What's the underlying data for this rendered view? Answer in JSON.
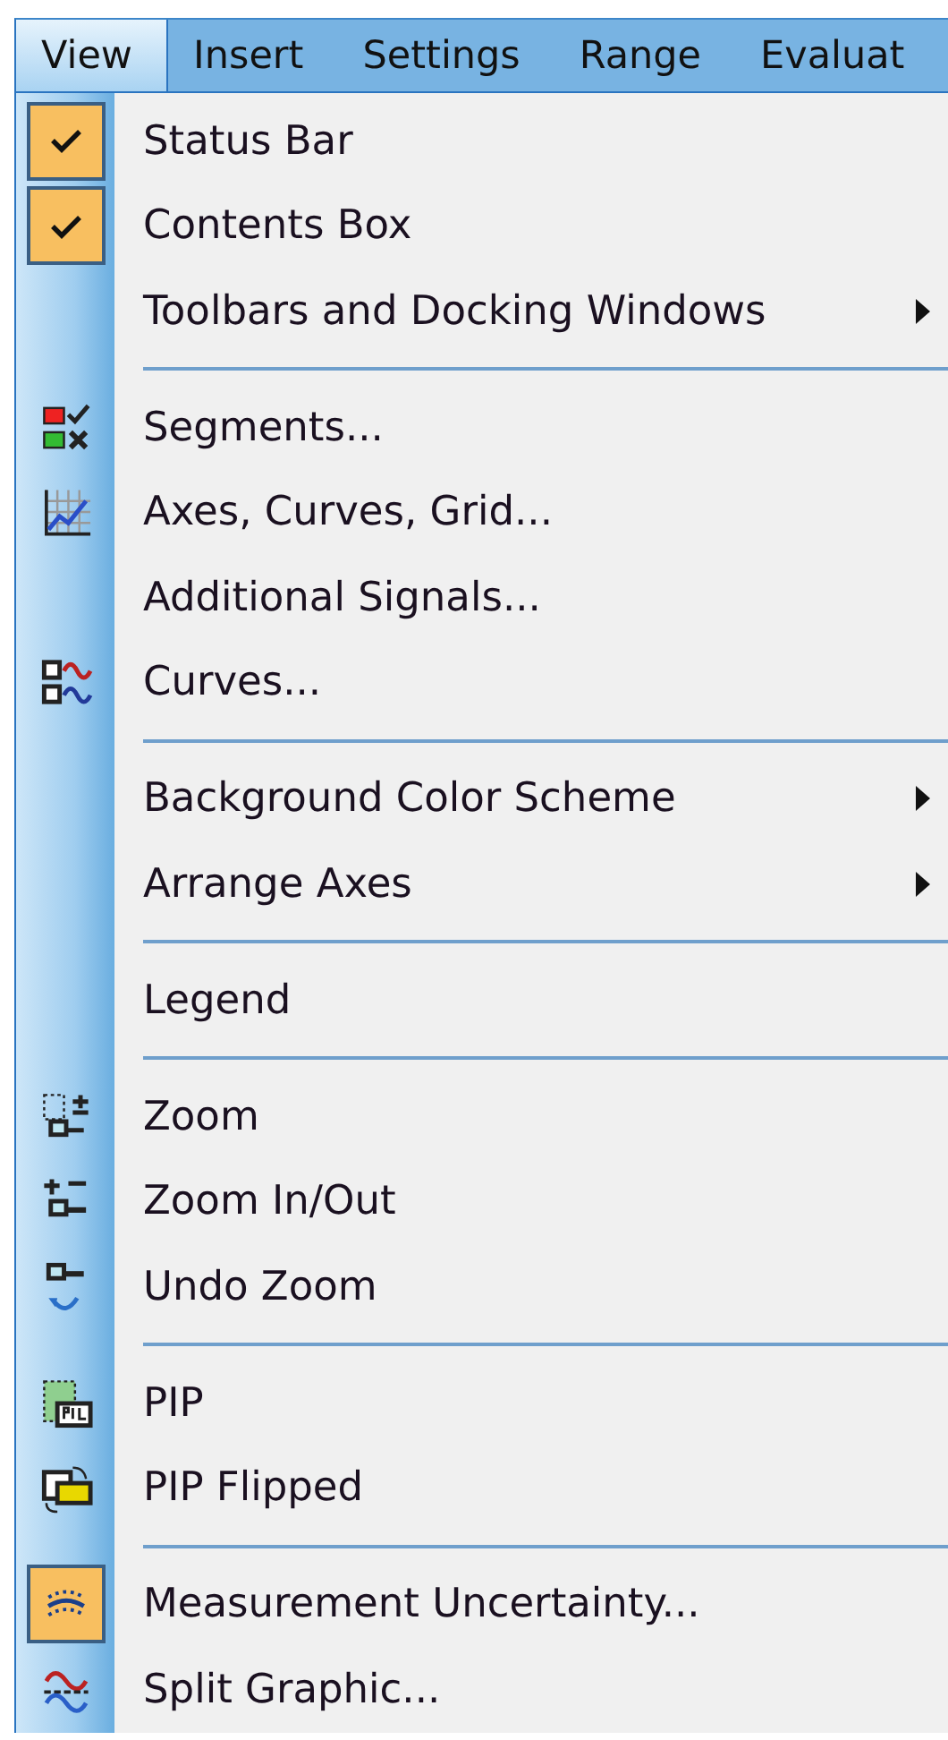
{
  "menu_bar": [
    {
      "label": "View",
      "selected": true
    },
    {
      "label": "Insert",
      "selected": false
    },
    {
      "label": "Settings",
      "selected": false
    },
    {
      "label": "Range",
      "selected": false
    },
    {
      "label": "Evaluat",
      "selected": false
    }
  ],
  "menu_items": [
    {
      "kind": "item",
      "label": "Status Bar",
      "checked": true,
      "icon": false,
      "submenu": false
    },
    {
      "kind": "item",
      "label": "Contents Box",
      "checked": true,
      "icon": false,
      "submenu": false
    },
    {
      "kind": "item",
      "label": "Toolbars and Docking Windows",
      "checked": false,
      "icon": false,
      "submenu": true
    },
    {
      "kind": "separator"
    },
    {
      "kind": "item",
      "label": "Segments...",
      "checked": false,
      "icon": true,
      "submenu": false
    },
    {
      "kind": "item",
      "label": "Axes, Curves, Grid...",
      "checked": false,
      "icon": true,
      "submenu": false
    },
    {
      "kind": "item",
      "label": "Additional Signals...",
      "checked": false,
      "icon": false,
      "submenu": false
    },
    {
      "kind": "item",
      "label": "Curves...",
      "checked": false,
      "icon": true,
      "submenu": false
    },
    {
      "kind": "separator"
    },
    {
      "kind": "item",
      "label": "Background Color Scheme",
      "checked": false,
      "icon": false,
      "submenu": true
    },
    {
      "kind": "item",
      "label": "Arrange Axes",
      "checked": false,
      "icon": false,
      "submenu": true
    },
    {
      "kind": "separator"
    },
    {
      "kind": "item",
      "label": "Legend",
      "checked": false,
      "icon": false,
      "submenu": false
    },
    {
      "kind": "separator"
    },
    {
      "kind": "item",
      "label": "Zoom",
      "checked": false,
      "icon": true,
      "submenu": false
    },
    {
      "kind": "item",
      "label": "Zoom In/Out",
      "checked": false,
      "icon": true,
      "submenu": false
    },
    {
      "kind": "item",
      "label": "Undo Zoom",
      "checked": false,
      "icon": true,
      "submenu": false
    },
    {
      "kind": "separator"
    },
    {
      "kind": "item",
      "label": "PIP",
      "checked": false,
      "icon": true,
      "submenu": false
    },
    {
      "kind": "item",
      "label": "PIP Flipped",
      "checked": false,
      "icon": true,
      "submenu": false
    },
    {
      "kind": "separator"
    },
    {
      "kind": "item",
      "label": "Measurement Uncertainty...",
      "checked": true,
      "icon": true,
      "submenu": false
    },
    {
      "kind": "item",
      "label": "Split Graphic...",
      "checked": false,
      "icon": true,
      "submenu": false
    }
  ]
}
